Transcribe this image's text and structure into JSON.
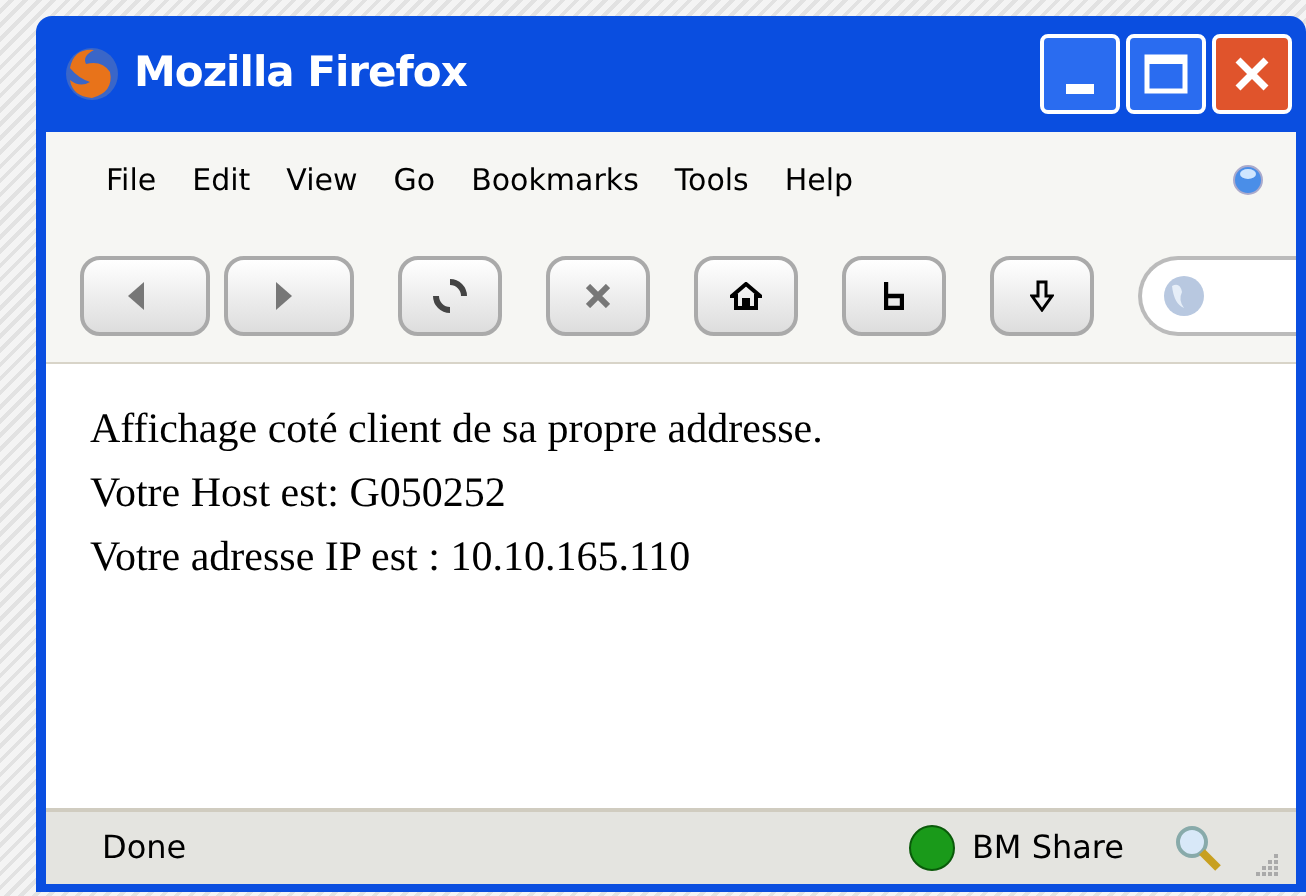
{
  "window": {
    "title": "Mozilla Firefox"
  },
  "menu": [
    "File",
    "Edit",
    "View",
    "Go",
    "Bookmarks",
    "Tools",
    "Help"
  ],
  "content": [
    "Affichage coté client de sa propre addresse.",
    "Votre Host est: G050252",
    "Votre adresse IP est : 10.10.165.110"
  ],
  "status_bar": {
    "text": "Done",
    "share": "BM Share"
  }
}
